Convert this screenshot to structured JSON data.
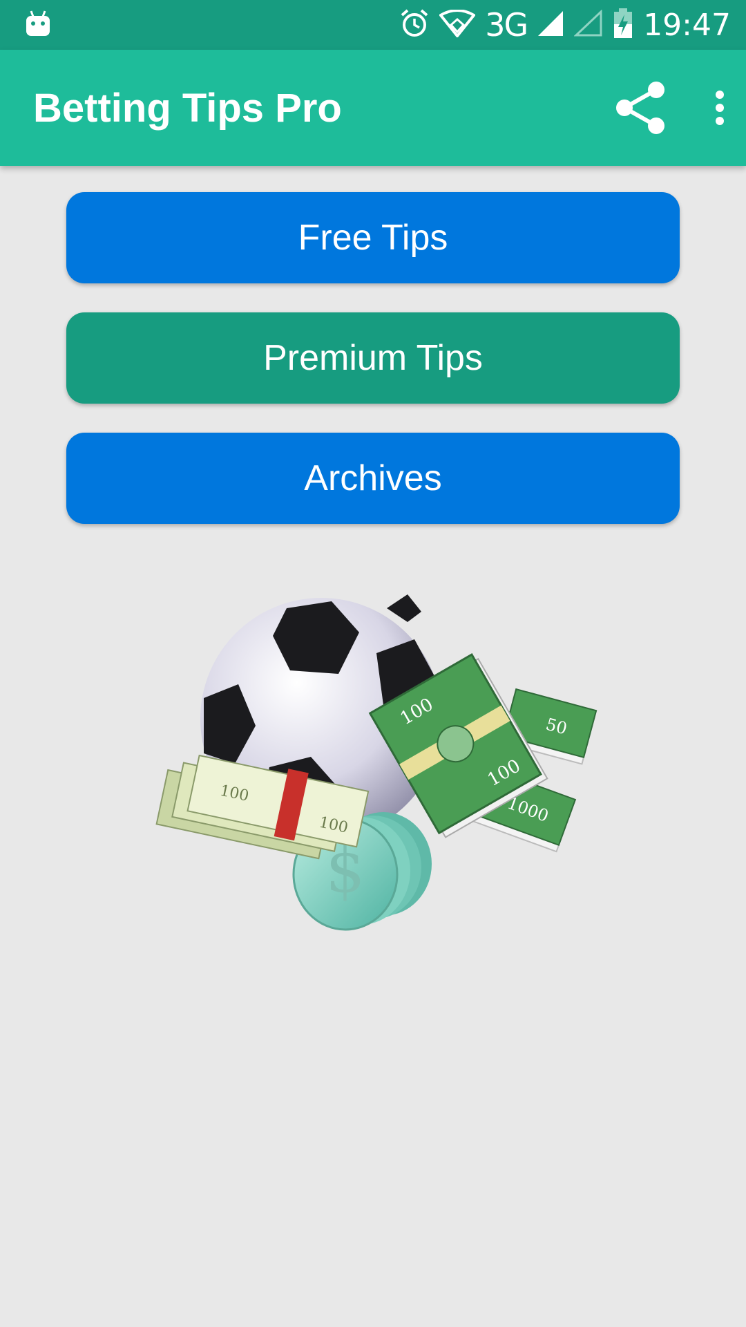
{
  "status_bar": {
    "network": "3G",
    "time": "19:47",
    "icons": [
      "android-icon",
      "alarm-icon",
      "wifi-icon",
      "signal-icon",
      "signal-empty-icon",
      "battery-charging-icon"
    ]
  },
  "app_bar": {
    "title": "Betting Tips Pro",
    "icons": [
      "share-icon",
      "more-vert-icon"
    ]
  },
  "menu": {
    "free_tips": "Free Tips",
    "premium_tips": "Premium Tips",
    "archives": "Archives"
  },
  "hero_labels": {
    "note_100_a": "100",
    "note_100_b": "100",
    "note_100_c": "100",
    "note_100_d": "100",
    "note_50": "50",
    "note_1000": "1000",
    "dollar": "$"
  },
  "colors": {
    "status_bar": "#179c80",
    "app_bar": "#1ebc9a",
    "free_tips_button": "#0077dd",
    "premium_tips_button": "#179c80",
    "archives_button": "#0077dd",
    "background": "#e8e8e8"
  }
}
